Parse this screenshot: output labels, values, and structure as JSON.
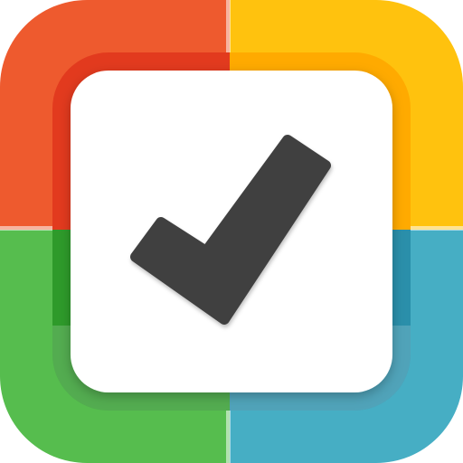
{
  "icon": {
    "name": "checklist-app-icon",
    "glyph": "checkmark-icon",
    "colors": {
      "top_left": "#EE5A2E",
      "top_left_inner": "#E23A1E",
      "top_right": "#FFC20E",
      "top_right_inner": "#FFAA00",
      "bottom_left": "#56BD4E",
      "bottom_left_inner": "#2E9A2A",
      "bottom_right": "#46AEC4",
      "bottom_right_inner": "#2A8FAA",
      "center_panel": "#FFFFFF",
      "checkmark": "#404040"
    }
  }
}
